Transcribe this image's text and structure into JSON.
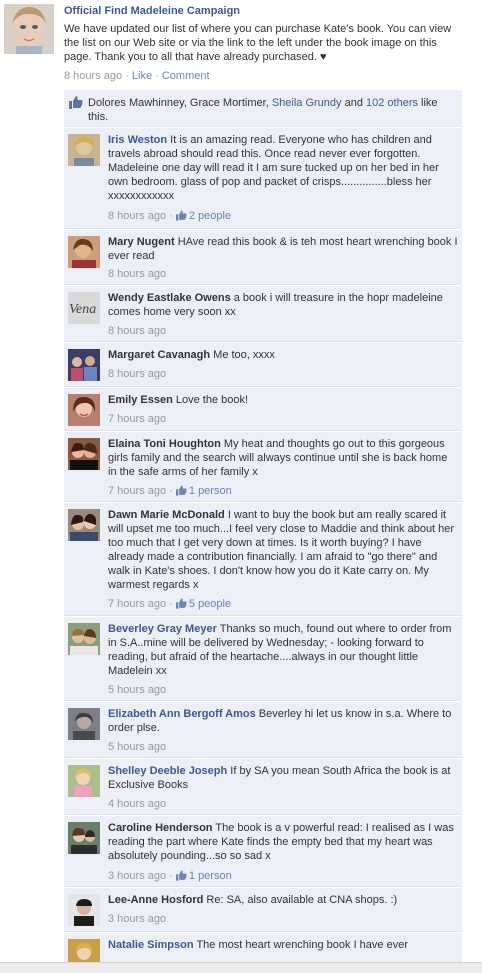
{
  "post": {
    "author": "Official Find Madeleine Campaign",
    "text": "We have updated our list of where you can purchase Kate's book. You can view the list on our Web site or via the link to the left under the book image on this page. Thank you to all that have already purchased. ♥",
    "time": "8 hours ago",
    "sep1": " · ",
    "like_label": "Like",
    "sep2": " · ",
    "comment_label": "Comment"
  },
  "likes": {
    "names_prefix": "Dolores Mawhinney, Grace Mortimer, ",
    "link_name": "Sheila Grundy",
    "and": " and ",
    "others": "102 others",
    "suffix": " like this."
  },
  "comments": [
    {
      "name": "Iris Weston",
      "text": "It is an amazing read. Everyone who has children and travels abroad should read this. Once read never ever forgotten. Madeleine one day will read it I am sure tucked up on her bed in her own bedroom. glass of pop and packet of crisps...............bless her xxxxxxxxxxxx",
      "time": "8 hours ago",
      "sep": " · ",
      "likes": "2 people"
    },
    {
      "name": "Mary Nugent",
      "text": "HAve read this book & is teh most heart wrenching book I ever read",
      "time": "8 hours ago"
    },
    {
      "name": "Wendy Eastlake Owens",
      "text": "a book i will treasure in the hopr madeleine comes home very soon xx",
      "time": "8 hours ago",
      "avatar_text": "Vena"
    },
    {
      "name": "Margaret Cavanagh",
      "text": "Me too, xxxx",
      "time": "8 hours ago"
    },
    {
      "name": "Emily Essen",
      "text": "Love the book!",
      "time": "7 hours ago"
    },
    {
      "name": "Elaina Toni Houghton",
      "text": "My heat and thoughts go out to this gorgeous girls family and the search will always continue until she is back home in the safe arms of her family x",
      "time": "7 hours ago",
      "sep": " · ",
      "likes": "1 person"
    },
    {
      "name": "Dawn Marie McDonald",
      "text": "I want to buy the book but am really scared it will upset me too much...I feel very close to Maddie and think about her too much that I get very down at times. Is it worth buying? I have already made a contribution financially. I am afraid to \"go there\" and walk in Kate's shoes. I don't know how you do it Kate carry on. My warmest regards x",
      "time": "7 hours ago",
      "sep": " · ",
      "likes": "5 people"
    },
    {
      "name": "Beverley Gray Meyer",
      "text": "Thanks so much, found out where to order from in S.A..mine will be delivered by Wednesday; - looking forward to reading, but afraid of the heartache....always in our thought little Madelein xx",
      "time": "5 hours ago"
    },
    {
      "name": "Elizabeth Ann Bergoff Amos",
      "text": "Beverley hi let us know in s.a. Where to order plse.",
      "time": "5 hours ago"
    },
    {
      "name": "Shelley Deeble Joseph",
      "text": "If by SA you mean South Africa the book is at Exclusive Books",
      "time": "4 hours ago"
    },
    {
      "name": "Caroline Henderson",
      "text": "The book is a v powerful read: I realised as I was reading the part where Kate finds the empty bed that my heart was absolutely pounding...so so sad x",
      "time": "3 hours ago",
      "sep": " · ",
      "likes": "1 person"
    },
    {
      "name": "Lee-Anne Hosford",
      "text": "Re: SA, also available at CNA shops. :)",
      "time": "3 hours ago"
    },
    {
      "name": "Natalie Simpson",
      "text": "The most heart wrenching book I have ever",
      "time": ""
    }
  ],
  "colors": {
    "link_blue": "#3b5998",
    "comment_bg": "#eceff5",
    "meta_gray": "#999999"
  }
}
